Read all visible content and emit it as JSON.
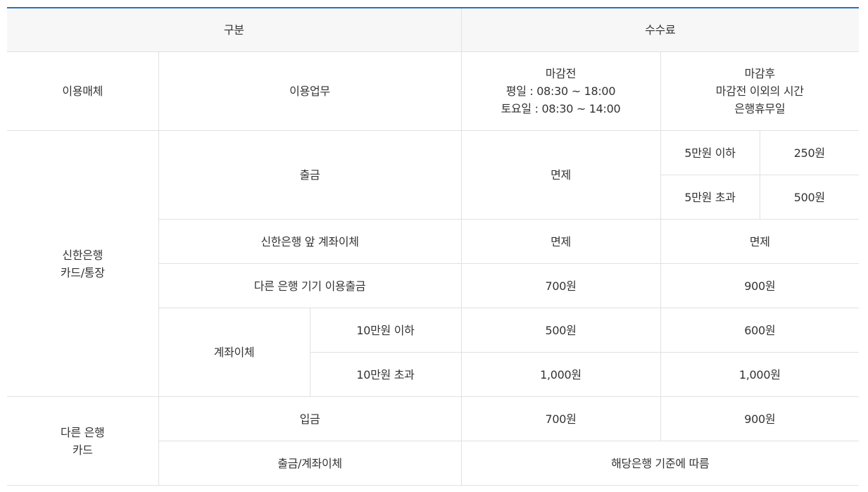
{
  "table": {
    "header": {
      "category": "구분",
      "fee": "수수료"
    },
    "subheader": {
      "media": "이용매체",
      "service": "이용업무",
      "before_close": [
        "마감전",
        "평일 : 08:30 ~ 18:00",
        "토요일 : 08:30 ~ 14:00"
      ],
      "after_close": [
        "마감후",
        "마감전 이외의 시간",
        "은행휴무일"
      ]
    },
    "shinhan": {
      "media": [
        "신한은행",
        "카드/통장"
      ],
      "withdraw": {
        "label": "출금",
        "before": "면제",
        "after_rows": [
          {
            "range": "5만원 이하",
            "fee": "250원"
          },
          {
            "range": "5만원 초과",
            "fee": "500원"
          }
        ]
      },
      "transfer_front": {
        "label": "신한은행 앞 계좌이체",
        "before": "면제",
        "after": "면제"
      },
      "other_atm": {
        "label": "다른 은행 기기 이용출금",
        "before": "700원",
        "after": "900원"
      },
      "transfer": {
        "label": "계좌이체",
        "rows": [
          {
            "range": "10만원 이하",
            "before": "500원",
            "after": "600원"
          },
          {
            "range": "10만원 초과",
            "before": "1,000원",
            "after": "1,000원"
          }
        ]
      }
    },
    "other_bank": {
      "media": [
        "다른 은행",
        "카드"
      ],
      "deposit": {
        "label": "입금",
        "before": "700원",
        "after": "900원"
      },
      "withdraw_transfer": {
        "label": "출금/계좌이체",
        "fee": "해당은행 기준에 따름"
      }
    }
  }
}
